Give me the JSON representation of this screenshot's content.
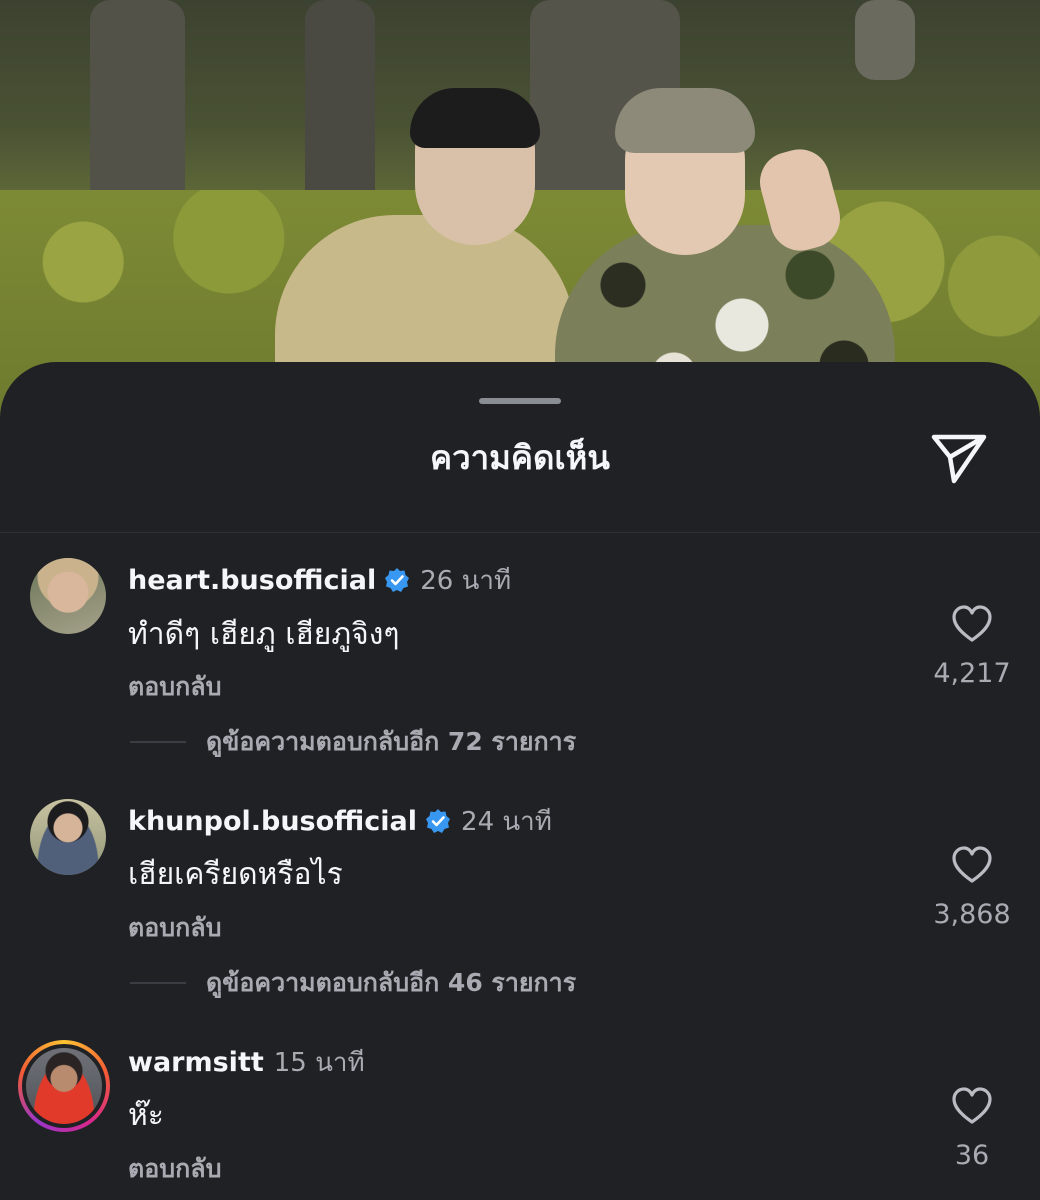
{
  "sheet": {
    "title": "ความคิดเห็น",
    "share_icon": "send-icon"
  },
  "comments": [
    {
      "username": "heart.busofficial",
      "verified": true,
      "time": "26 นาที",
      "text": "ทำดีๆ เฮียภู เฮียภูจิงๆ",
      "reply_label": "ตอบกลับ",
      "like_count": "4,217",
      "view_replies": "ดูข้อความตอบกลับอีก 72 รายการ"
    },
    {
      "username": "khunpol.busofficial",
      "verified": true,
      "time": "24 นาที",
      "text": "เฮียเครียดหรือไร",
      "reply_label": "ตอบกลับ",
      "like_count": "3,868",
      "view_replies": "ดูข้อความตอบกลับอีก 46 รายการ"
    },
    {
      "username": "warmsitt",
      "verified": false,
      "time": "15 นาที",
      "text": "ห๊ะ",
      "reply_label": "ตอบกลับ",
      "like_count": "36",
      "has_story": true
    }
  ],
  "colors": {
    "sheet_bg": "#1f2125",
    "verified_blue": "#3897f0",
    "muted_text": "#a8abb1"
  }
}
